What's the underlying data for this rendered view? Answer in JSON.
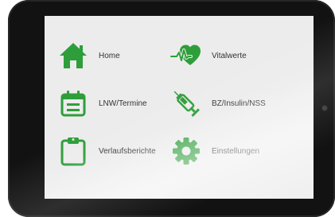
{
  "menu": {
    "items": [
      {
        "label": "Home",
        "icon": "home-icon"
      },
      {
        "label": "Vitalwerte",
        "icon": "heartbeat-icon"
      },
      {
        "label": "LNW/Termine",
        "icon": "calendar-icon"
      },
      {
        "label": "BZ/Insulin/NSS",
        "icon": "syringe-icon"
      },
      {
        "label": "Verlaufsberichte",
        "icon": "clipboard-icon"
      },
      {
        "label": "Einstellungen",
        "icon": "gear-icon"
      }
    ]
  },
  "colors": {
    "accent": "#2e9e3a",
    "screen_background": "#ececec",
    "bezel": "#121212",
    "label": "#333333"
  }
}
